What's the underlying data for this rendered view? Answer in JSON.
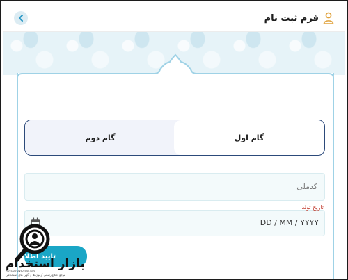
{
  "header": {
    "title": "فرم ثبت نام",
    "back_icon": "chevron-left-icon",
    "user_icon": "user-icon"
  },
  "steps": {
    "first": "گام اول",
    "second": "گام دوم",
    "active": "first"
  },
  "form": {
    "national_code_placeholder": "کدملی",
    "birth_date_label": "تاریخ تولد",
    "birth_date_format": "DD / MM / YYYY",
    "calendar_icon": "calendar-icon"
  },
  "confirm_button": {
    "label": "تایید اطلا"
  },
  "watermark": {
    "brand": "بازار استخدام",
    "site": "bazarestekhdam.com",
    "tagline": "مرجع اطلاع رسانی آزمون ها و آگهی های استخدامی"
  },
  "colors": {
    "accent": "#1aa6c6",
    "tab_border": "#2c4a7a",
    "pattern_bg": "#e6f3f8",
    "label_red": "#c0392b"
  }
}
